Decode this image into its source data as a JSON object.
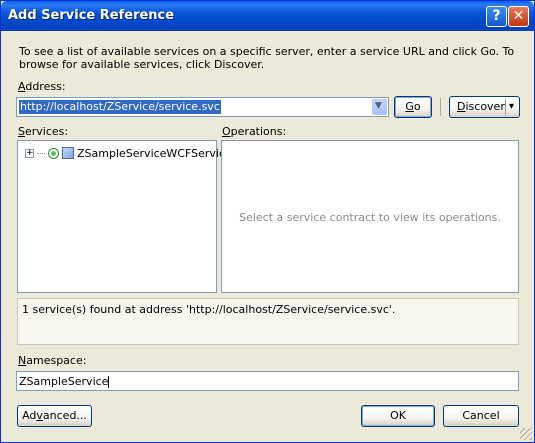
{
  "window": {
    "title": "Add Service Reference",
    "help_icon": "?",
    "close_icon": "✕"
  },
  "description": "To see a list of available services on a specific server, enter a service URL and click Go. To browse for available services, click Discover.",
  "address": {
    "label_accel": "A",
    "label_rest": "ddress:",
    "value": "http://localhost/ZService/service.svc"
  },
  "buttons": {
    "go_accel": "G",
    "go_rest": "o",
    "discover_accel": "D",
    "discover_rest": "iscover",
    "advanced_pre": "Ad",
    "advanced_accel": "v",
    "advanced_post": "anced...",
    "ok": "OK",
    "cancel": "Cancel"
  },
  "services": {
    "label_accel": "S",
    "label_rest": "ervices:",
    "items": [
      {
        "name": "ZSampleServiceWCFService",
        "expand_icon": "+"
      }
    ]
  },
  "operations": {
    "label_accel": "O",
    "label_rest": "perations:",
    "empty_text": "Select a service contract to view its operations."
  },
  "status": "1 service(s) found at address 'http://localhost/ZService/service.svc'.",
  "namespace": {
    "label_accel": "N",
    "label_rest": "amespace:",
    "value": "ZSampleService"
  },
  "icons": {
    "dropdown": "▼",
    "discover_dropdown": "▾"
  }
}
